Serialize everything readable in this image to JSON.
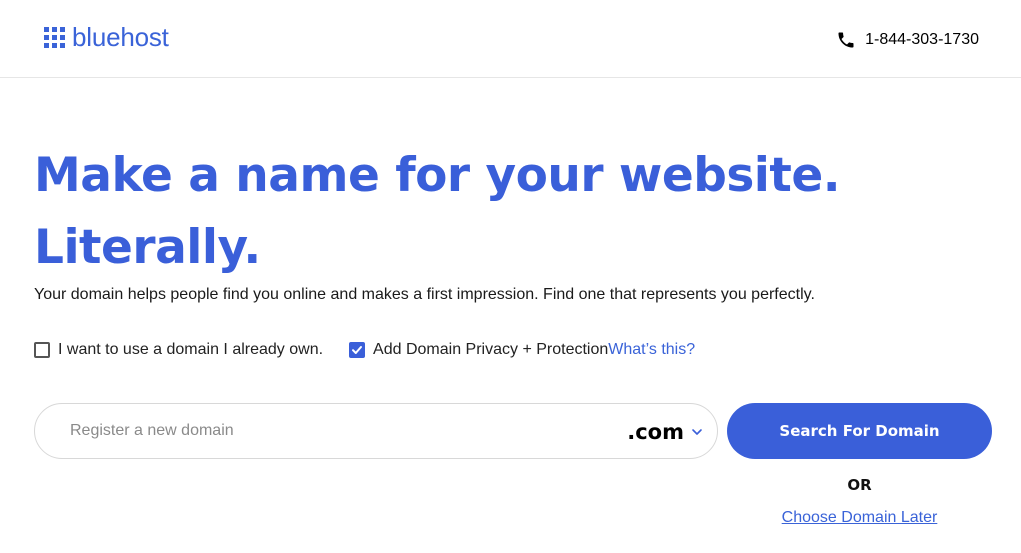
{
  "header": {
    "logo_text": "bluehost",
    "phone": "1-844-303-1730"
  },
  "hero": {
    "headline_line1": "Make a name for your website.",
    "headline_line2": "Literally.",
    "subtext": "Your domain helps people find you online and makes a first impression. Find one that represents you perfectly."
  },
  "options": {
    "own_domain_label": "I want to use a domain I already own.",
    "own_domain_checked": false,
    "privacy_label": "Add Domain Privacy + Protection",
    "privacy_checked": true,
    "whats_this_label": "What’s this?"
  },
  "search": {
    "placeholder": "Register a new domain",
    "tld": ".com",
    "button_label": "Search For Domain",
    "or_label": "OR",
    "choose_later_label": "Choose Domain Later"
  },
  "colors": {
    "brand_blue": "#3a5fd9"
  },
  "icons": {
    "logo": "grid-logo-icon",
    "phone": "phone-icon",
    "checkbox_checked": "checkmark-icon",
    "tld_dropdown": "chevron-down-icon"
  }
}
